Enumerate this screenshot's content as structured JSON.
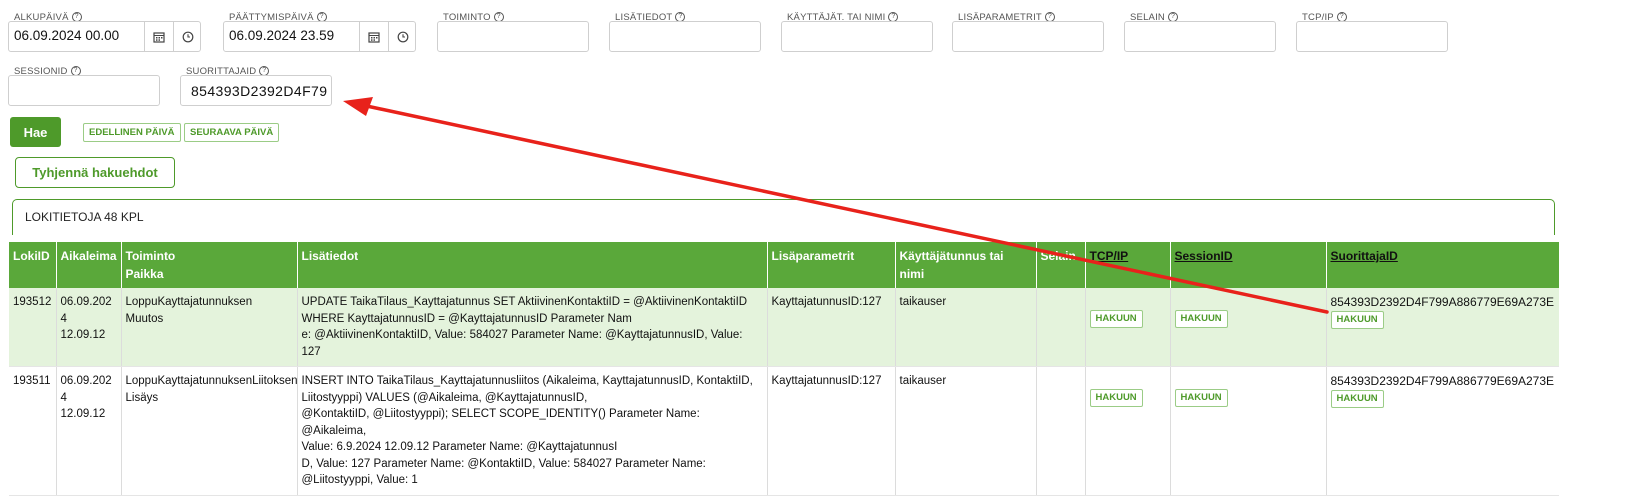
{
  "filters": {
    "alkupaiva": {
      "label": "ALKUPÄIVÄ",
      "value": "06.09.2024 00.00"
    },
    "paattymispaiva": {
      "label": "PÄÄTTYMISPÄIVÄ",
      "value": "06.09.2024 23.59"
    },
    "toiminto": {
      "label": "TOIMINTO",
      "value": ""
    },
    "lisatiedot": {
      "label": "LISÄTIEDOT",
      "value": ""
    },
    "kayttajat": {
      "label": "KÄYTTÄJÄT. TAI NIMI",
      "value": ""
    },
    "lisaparametrit": {
      "label": "LISÄPARAMETRIT",
      "value": ""
    },
    "selain": {
      "label": "SELAIN",
      "value": ""
    },
    "tcpip": {
      "label": "TCP/IP",
      "value": ""
    },
    "sessionid": {
      "label": "SESSIONID",
      "value": ""
    },
    "suorittajaid": {
      "label": "SUORITTAJAID",
      "value": "854393D2392D4F79"
    }
  },
  "buttons": {
    "hae": "Hae",
    "edellinen": "EDELLINEN PÄIVÄ",
    "seuraava": "SEURAAVA PÄIVÄ",
    "tyhjenna": "Tyhjennä hakuehdot"
  },
  "panel_title": "LOKITIETOJA 48 KPL",
  "table": {
    "headers": {
      "lokiid": "LokiID",
      "aikaleima": "Aikaleima",
      "toiminto": "Toiminto",
      "paikka": "Paikka",
      "lisatiedot": "Lisätiedot",
      "lisaparametrit": "Lisäparametrit",
      "kayttajatunnus": "Käyttäjätunnus tai nimi",
      "selain": "Selain",
      "tcpip": "TCP/IP",
      "sessionid": "SessionID",
      "suorittajaid": "SuorittajaID"
    },
    "hakuun": "HAKUUN",
    "rows": [
      {
        "lokiid": "193512",
        "date": "06.09.2024",
        "time": "12.09.12",
        "toiminto": "LoppuKayttajatunnuksen",
        "paikka": "Muutos",
        "lisatiedot_lines": [
          "UPDATE TaikaTilaus_Kayttajatunnus SET AktiivinenKontaktiID = @AktiivinenKontaktiID",
          "WHERE KayttajatunnusID = @KayttajatunnusID Parameter Nam",
          "e: @AktiivinenKontaktiID, Value: 584027 Parameter Name: @KayttajatunnusID, Value: 127"
        ],
        "lisaparametrit": "KayttajatunnusID:127",
        "kayttajatunnus": "taikauser",
        "suorittajaid": "854393D2392D4F799A886779E69A273E"
      },
      {
        "lokiid": "193511",
        "date": "06.09.2024",
        "time": "12.09.12",
        "toiminto": "LoppuKayttajatunnuksenLiitoksen",
        "paikka": "Lisäys",
        "lisatiedot_lines": [
          "INSERT INTO TaikaTilaus_Kayttajatunnusliitos (Aikaleima, KayttajatunnusID, KontaktiID,",
          "Liitostyyppi) VALUES (@Aikaleima, @KayttajatunnusID,",
          "@KontaktiID, @Liitostyyppi); SELECT SCOPE_IDENTITY() Parameter Name: @Aikaleima,",
          "Value: 6.9.2024 12.09.12 Parameter Name: @KayttajatunnusI",
          "D, Value: 127 Parameter Name: @KontaktiID, Value: 584027 Parameter Name:",
          "@Liitostyyppi, Value: 1"
        ],
        "lisaparametrit": "KayttajatunnusID:127",
        "kayttajatunnus": "taikauser",
        "suorittajaid": "854393D2392D4F799A886779E69A273E"
      }
    ]
  },
  "colors": {
    "accent": "#4e9a2a",
    "header_bg": "#5aa83a",
    "row_highlight": "#e4f3dc",
    "arrow": "#e8221b"
  }
}
